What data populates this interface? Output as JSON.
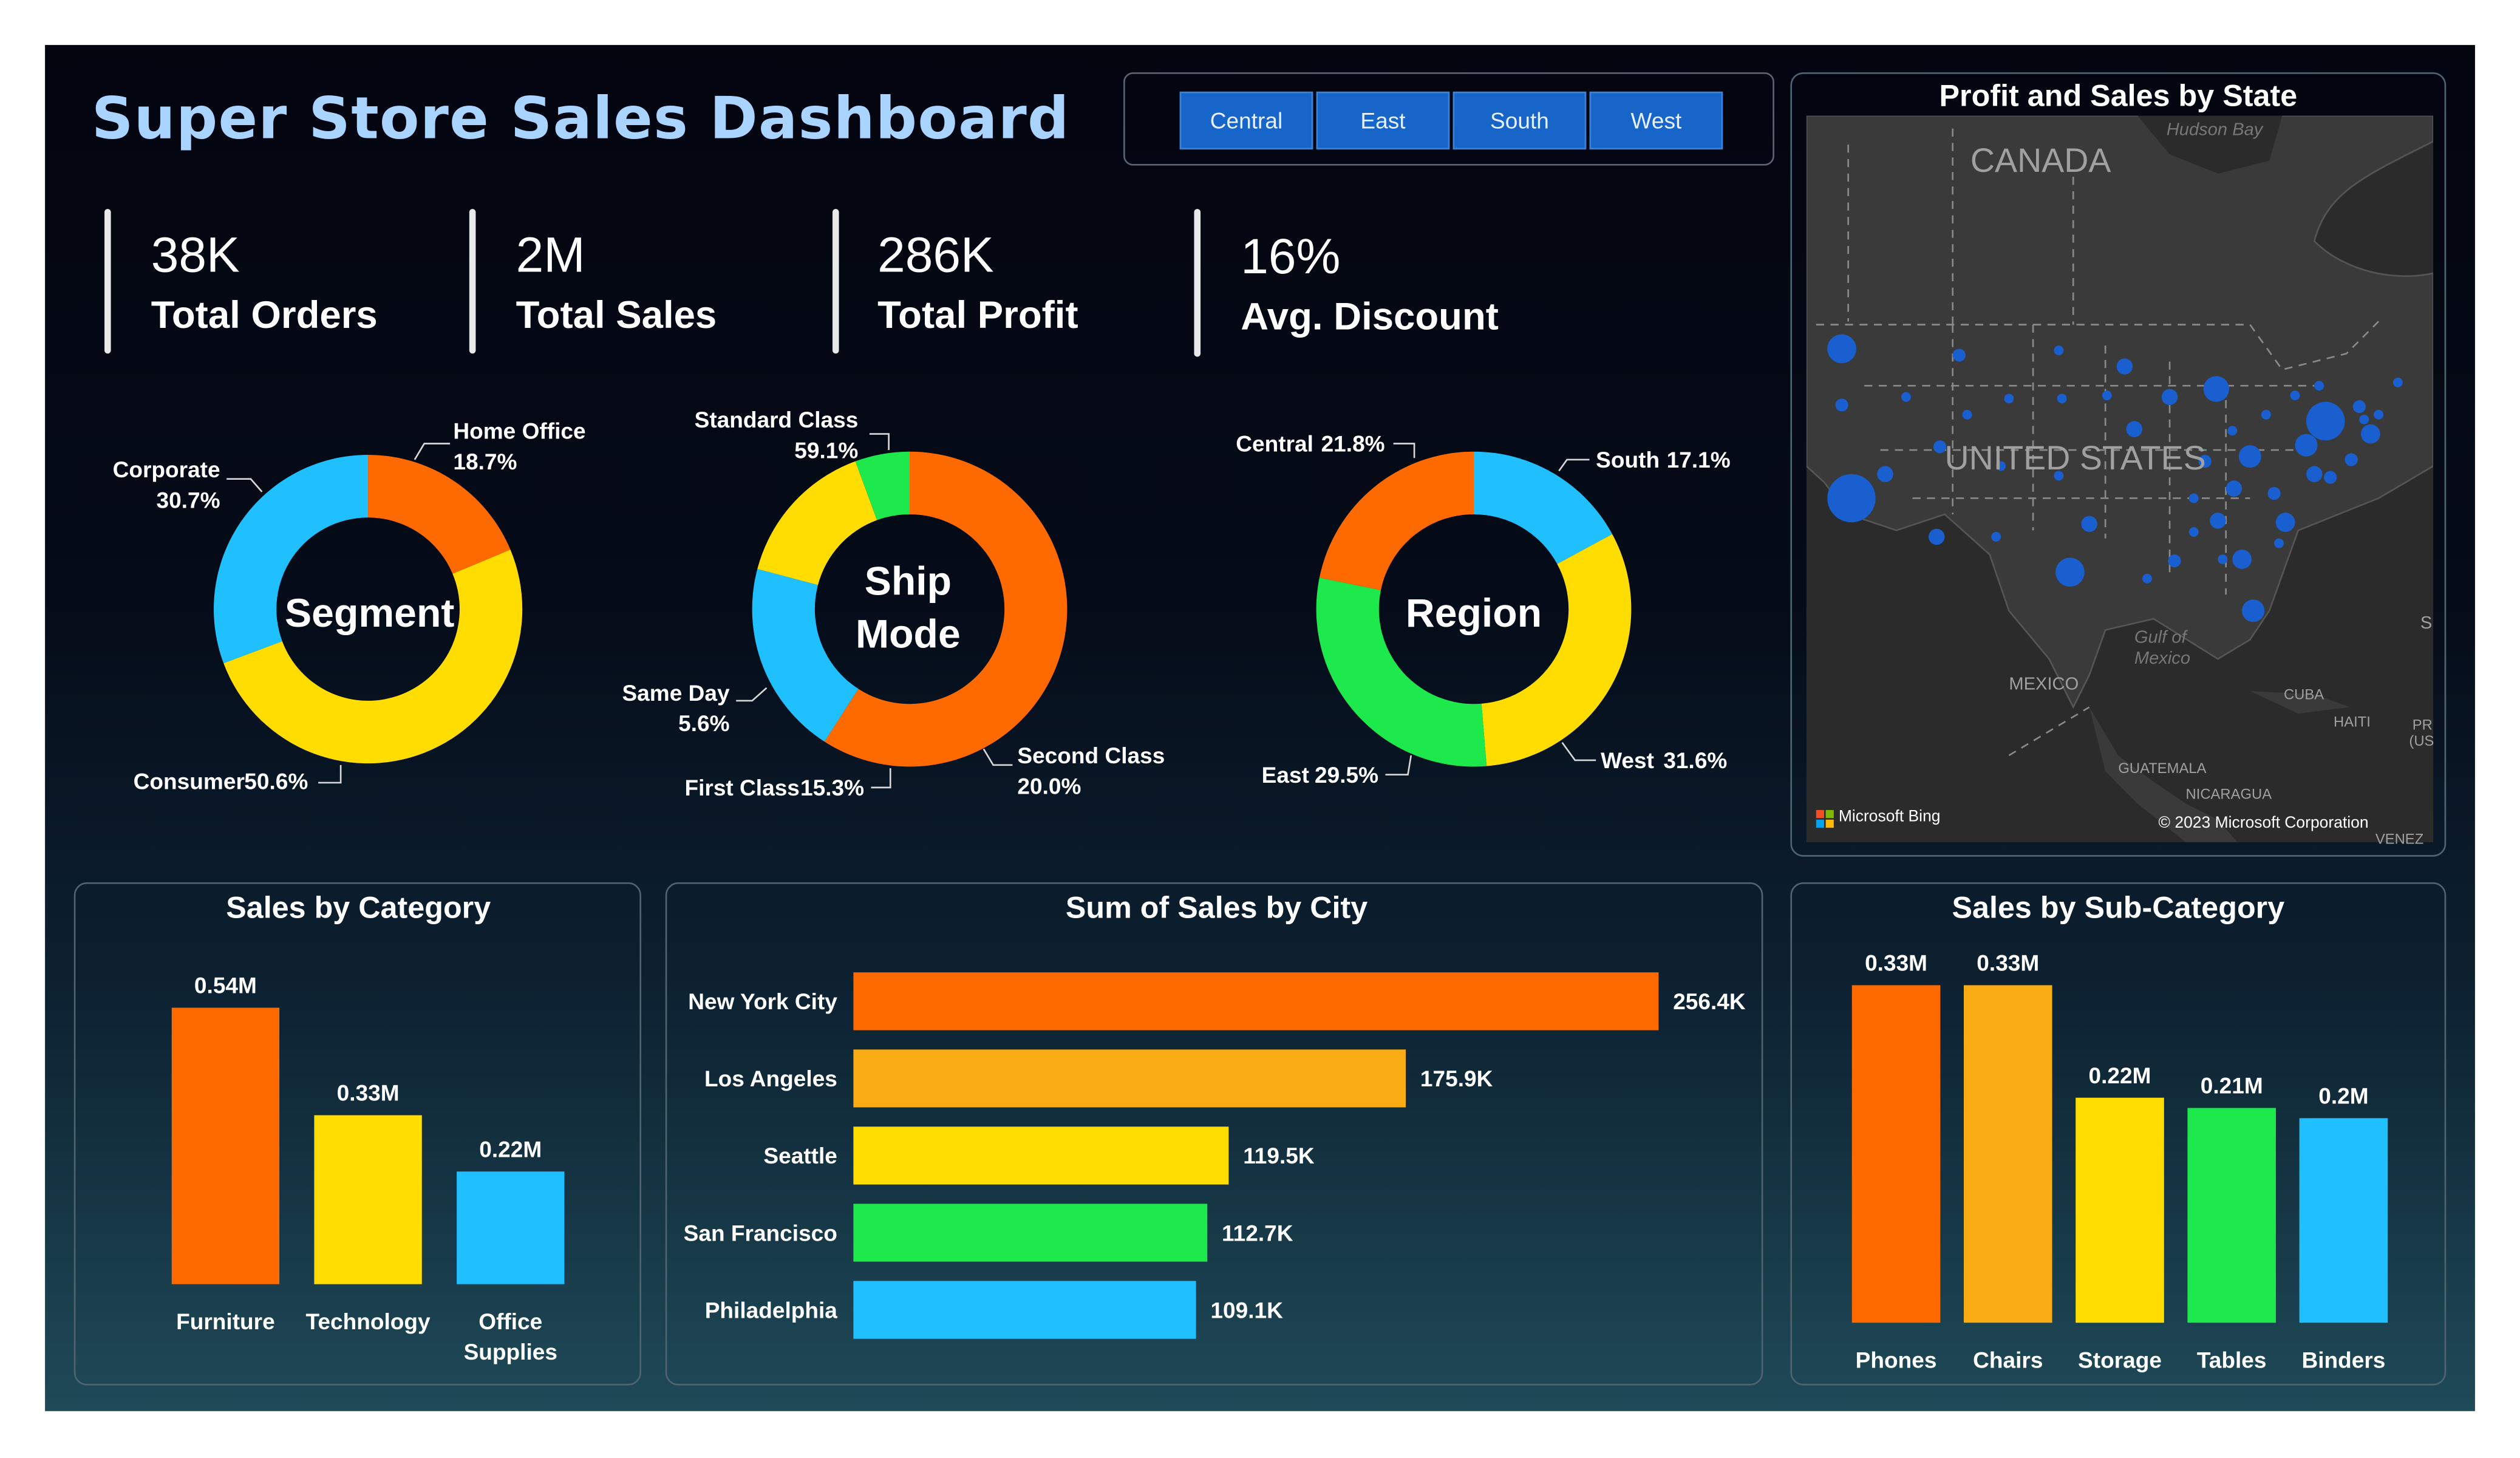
{
  "title": "Super Store Sales Dashboard",
  "slicer": [
    "Central",
    "East",
    "South",
    "West"
  ],
  "kpis": [
    {
      "value": "38K",
      "label": "Total Orders"
    },
    {
      "value": "2M",
      "label": "Total Sales"
    },
    {
      "value": "286K",
      "label": "Total Profit"
    },
    {
      "value": "16%",
      "label": "Avg. Discount"
    }
  ],
  "colors": {
    "orange": "#ff6a00",
    "amber": "#f9ab13",
    "yellow": "#ffdd00",
    "green": "#1de84c",
    "cyan": "#20c0ff",
    "map_bubble": "#1a5fd0"
  },
  "donuts": {
    "segment": {
      "center": "Segment",
      "slices": [
        {
          "name": "Home Office",
          "pct": "18.7%",
          "value": 18.7,
          "color": "#ff6a00"
        },
        {
          "name": "Consumer",
          "pct": "50.6%",
          "value": 50.6,
          "color": "#ffdd00"
        },
        {
          "name": "Corporate",
          "pct": "30.7%",
          "value": 30.7,
          "color": "#20c0ff"
        }
      ]
    },
    "ship_mode": {
      "center_line1": "Ship",
      "center_line2": "Mode",
      "slices": [
        {
          "name": "Standard Class",
          "pct": "59.1%",
          "value": 59.1,
          "color": "#ff6a00"
        },
        {
          "name": "Second Class",
          "pct": "20.0%",
          "value": 20.0,
          "color": "#20c0ff"
        },
        {
          "name": "First Class",
          "pct": "15.3%",
          "value": 15.3,
          "color": "#ffdd00"
        },
        {
          "name": "Same Day",
          "pct": "5.6%",
          "value": 5.6,
          "color": "#1de84c"
        }
      ]
    },
    "region": {
      "center": "Region",
      "slices": [
        {
          "name": "South",
          "pct": "17.1%",
          "value": 17.1,
          "color": "#20c0ff"
        },
        {
          "name": "West",
          "pct": "31.6%",
          "value": 31.6,
          "color": "#ffdd00"
        },
        {
          "name": "East",
          "pct": "29.5%",
          "value": 29.5,
          "color": "#1de84c"
        },
        {
          "name": "Central",
          "pct": "21.8%",
          "value": 21.8,
          "color": "#ff6a00"
        }
      ]
    }
  },
  "map": {
    "title": "Profit and Sales by State",
    "labels": {
      "hudson": "Hudson Bay",
      "canada": "CANADA",
      "us": "UNITED STATES",
      "gulf1": "Gulf of",
      "gulf2": "Mexico",
      "mexico": "MEXICO",
      "cuba": "CUBA",
      "haiti": "HAITI",
      "pr1": "PR",
      "pr2": "(US",
      "guatemala": "GUATEMALA",
      "nicaragua": "NICARAGUA",
      "venez": "VENEZ",
      "s": "S"
    },
    "brand": "Microsoft Bing",
    "copyright": "© 2023 Microsoft Corporation"
  },
  "chart_data": [
    {
      "type": "bar",
      "title": "Sales by Category",
      "categories": [
        "Furniture",
        "Technology",
        "Office Supplies"
      ],
      "values": [
        0.54,
        0.33,
        0.22
      ],
      "value_labels": [
        "0.54M",
        "0.33M",
        "0.22M"
      ],
      "colors": [
        "#ff6a00",
        "#ffdd00",
        "#20c0ff"
      ]
    },
    {
      "type": "bar",
      "orientation": "horizontal",
      "title": "Sum of Sales by City",
      "categories": [
        "New York City",
        "Los Angeles",
        "Seattle",
        "San Francisco",
        "Philadelphia"
      ],
      "values": [
        256.4,
        175.9,
        119.5,
        112.7,
        109.1
      ],
      "value_labels": [
        "256.4K",
        "175.9K",
        "119.5K",
        "112.7K",
        "109.1K"
      ],
      "colors": [
        "#ff6a00",
        "#f9ab13",
        "#ffdd00",
        "#1de84c",
        "#20c0ff"
      ]
    },
    {
      "type": "bar",
      "title": "Sales by Sub-Category",
      "categories": [
        "Phones",
        "Chairs",
        "Storage",
        "Tables",
        "Binders"
      ],
      "values": [
        0.33,
        0.33,
        0.22,
        0.21,
        0.2
      ],
      "value_labels": [
        "0.33M",
        "0.33M",
        "0.22M",
        "0.21M",
        "0.2M"
      ],
      "colors": [
        "#ff6a00",
        "#f9ab13",
        "#ffdd00",
        "#1de84c",
        "#20c0ff"
      ]
    }
  ]
}
